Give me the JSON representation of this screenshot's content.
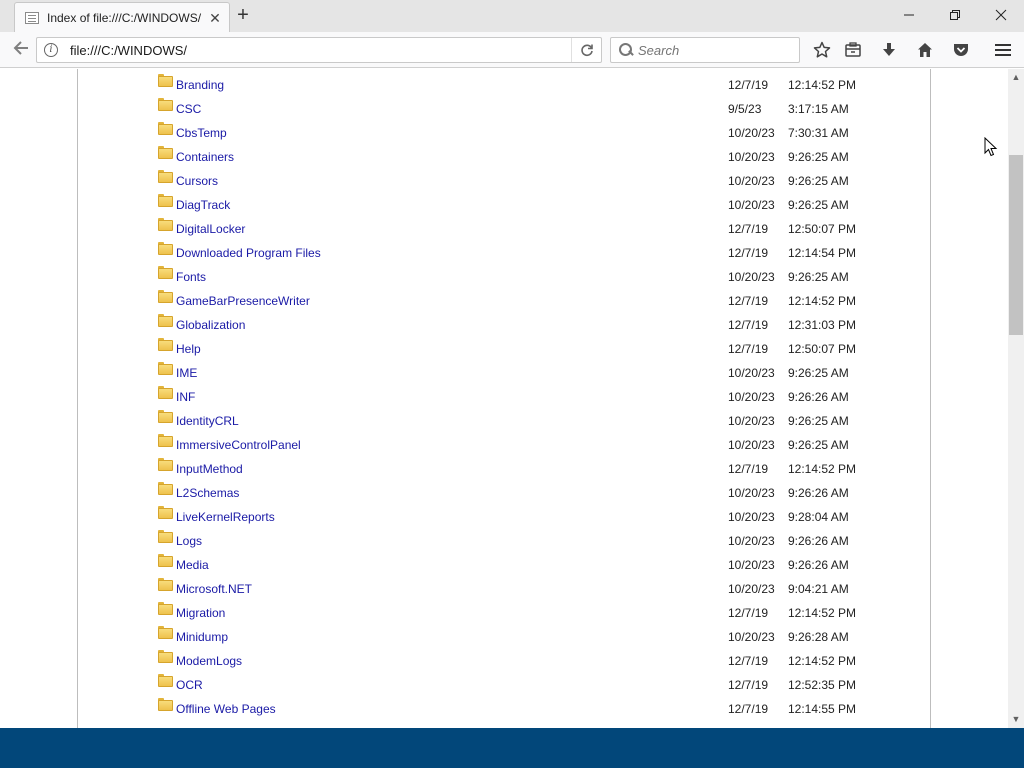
{
  "browser": {
    "tab_title": "Index of file:///C:/WINDOWS/",
    "url": "file:///C:/WINDOWS/",
    "search_placeholder": "Search",
    "icons": {
      "back": "arrow-left-icon",
      "info": "info-icon",
      "reload": "reload-icon",
      "search": "search-icon",
      "bookmark": "star-icon",
      "library": "library-icon",
      "downloads": "download-icon",
      "home": "home-icon",
      "pocket": "pocket-icon",
      "menu": "hamburger-icon"
    }
  },
  "listing": {
    "rows": [
      {
        "name": "Branding",
        "date": "12/7/19",
        "time": "12:14:52 PM"
      },
      {
        "name": "CSC",
        "date": "9/5/23",
        "time": "3:17:15 AM"
      },
      {
        "name": "CbsTemp",
        "date": "10/20/23",
        "time": "7:30:31 AM"
      },
      {
        "name": "Containers",
        "date": "10/20/23",
        "time": "9:26:25 AM"
      },
      {
        "name": "Cursors",
        "date": "10/20/23",
        "time": "9:26:25 AM"
      },
      {
        "name": "DiagTrack",
        "date": "10/20/23",
        "time": "9:26:25 AM"
      },
      {
        "name": "DigitalLocker",
        "date": "12/7/19",
        "time": "12:50:07 PM"
      },
      {
        "name": "Downloaded Program Files",
        "date": "12/7/19",
        "time": "12:14:54 PM"
      },
      {
        "name": "Fonts",
        "date": "10/20/23",
        "time": "9:26:25 AM"
      },
      {
        "name": "GameBarPresenceWriter",
        "date": "12/7/19",
        "time": "12:14:52 PM"
      },
      {
        "name": "Globalization",
        "date": "12/7/19",
        "time": "12:31:03 PM"
      },
      {
        "name": "Help",
        "date": "12/7/19",
        "time": "12:50:07 PM"
      },
      {
        "name": "IME",
        "date": "10/20/23",
        "time": "9:26:25 AM"
      },
      {
        "name": "INF",
        "date": "10/20/23",
        "time": "9:26:26 AM"
      },
      {
        "name": "IdentityCRL",
        "date": "10/20/23",
        "time": "9:26:25 AM"
      },
      {
        "name": "ImmersiveControlPanel",
        "date": "10/20/23",
        "time": "9:26:25 AM"
      },
      {
        "name": "InputMethod",
        "date": "12/7/19",
        "time": "12:14:52 PM"
      },
      {
        "name": "L2Schemas",
        "date": "10/20/23",
        "time": "9:26:26 AM"
      },
      {
        "name": "LiveKernelReports",
        "date": "10/20/23",
        "time": "9:28:04 AM"
      },
      {
        "name": "Logs",
        "date": "10/20/23",
        "time": "9:26:26 AM"
      },
      {
        "name": "Media",
        "date": "10/20/23",
        "time": "9:26:26 AM"
      },
      {
        "name": "Microsoft.NET",
        "date": "10/20/23",
        "time": "9:04:21 AM"
      },
      {
        "name": "Migration",
        "date": "12/7/19",
        "time": "12:14:52 PM"
      },
      {
        "name": "Minidump",
        "date": "10/20/23",
        "time": "9:26:28 AM"
      },
      {
        "name": "ModemLogs",
        "date": "12/7/19",
        "time": "12:14:52 PM"
      },
      {
        "name": "OCR",
        "date": "12/7/19",
        "time": "12:52:35 PM"
      },
      {
        "name": "Offline Web Pages",
        "date": "12/7/19",
        "time": "12:14:55 PM"
      }
    ]
  },
  "colors": {
    "link": "#1a1aa6",
    "taskbar": "#02477a",
    "folder": "#eec24d"
  }
}
